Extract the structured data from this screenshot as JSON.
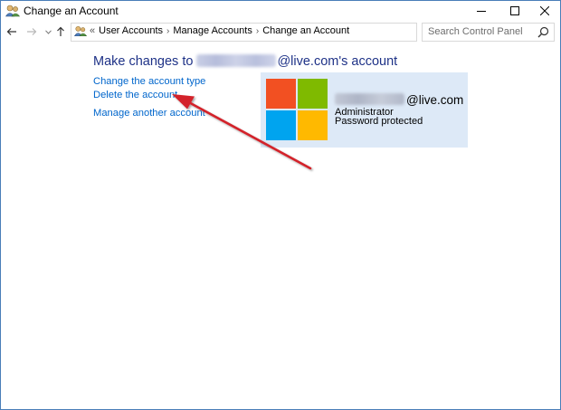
{
  "window": {
    "title": "Change an Account",
    "controls": {
      "minimize": "minimize",
      "maximize": "maximize",
      "close": "close"
    }
  },
  "navigation": {
    "breadcrumb_prefix": "«",
    "breadcrumbs": [
      "User Accounts",
      "Manage Accounts",
      "Change an Account"
    ],
    "search_placeholder": "Search Control Panel"
  },
  "content": {
    "heading_prefix": "Make changes to",
    "heading_suffix": "@live.com's account",
    "links": {
      "change_type": "Change the account type",
      "delete": "Delete the account",
      "manage_another": "Manage another account"
    }
  },
  "account": {
    "email_suffix": "@live.com",
    "role": "Administrator",
    "status": "Password protected",
    "logo_colors": [
      "#f25022",
      "#7fba00",
      "#00a4ef",
      "#ffb900"
    ]
  },
  "annotation": {
    "arrow_color": "#d3232a",
    "icon": "red-arrow"
  },
  "colors": {
    "link": "#0066cc",
    "heading": "#1e3287",
    "card": "#dde9f7"
  }
}
